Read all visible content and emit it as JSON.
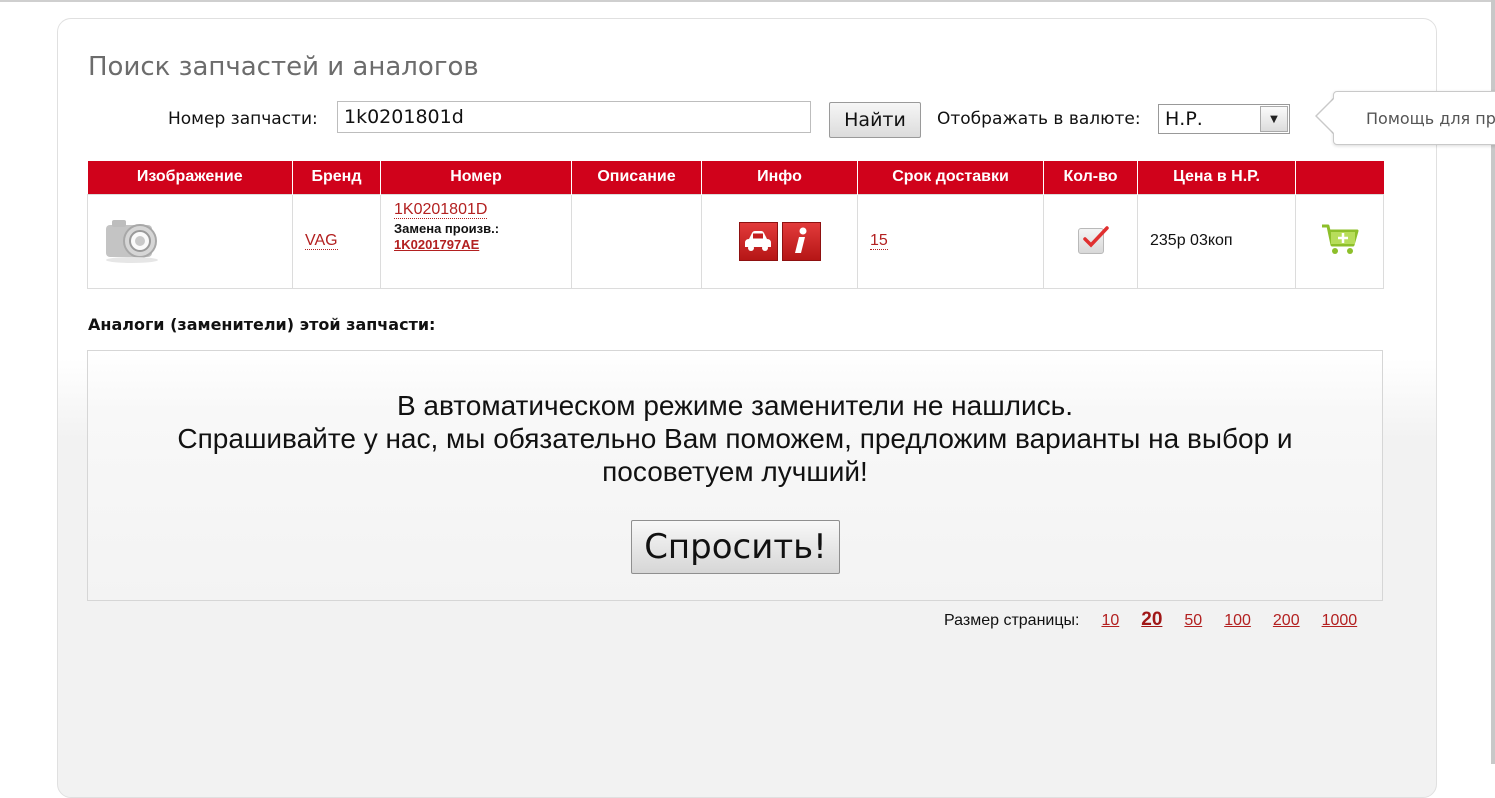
{
  "page": {
    "title": "Поиск запчастей и аналогов"
  },
  "search": {
    "label": "Номер запчасти:",
    "value": "1k0201801d",
    "button": "Найти",
    "currency_label": "Отображать в валюте:",
    "currency_value": "Н.Р."
  },
  "help": {
    "text": "Помощь для пр"
  },
  "table": {
    "headers": [
      "Изображение",
      "Бренд",
      "Номер",
      "Описание",
      "Инфо",
      "Срок доставки",
      "Кол-во",
      "Цена в Н.Р.",
      ""
    ],
    "rows": [
      {
        "image_icon": "camera-placeholder-icon",
        "brand": "VAG",
        "number": "1K0201801D",
        "replacement_label": "Замена произв.:",
        "replacement_number": "1K0201797AE",
        "description": "",
        "info_icons": [
          "car-icon",
          "info-icon"
        ],
        "delivery": "15",
        "qty_icon": "checkbox-checked-icon",
        "price": "235р 03коп",
        "cart_icon": "add-to-cart-icon"
      }
    ]
  },
  "analogs": {
    "title": "Аналоги (заменители) этой запчасти:",
    "message_line1": "В автоматическом режиме заменители не нашлись.",
    "message_line2": "Спрашивайте у нас, мы обязательно Вам поможем, предложим варианты на выбор и",
    "message_line3": "посоветуем лучший!",
    "ask_button": "Спросить!"
  },
  "pagination": {
    "label": "Размер страницы:",
    "sizes": [
      "10",
      "20",
      "50",
      "100",
      "200",
      "1000"
    ],
    "active": "20"
  },
  "colors": {
    "header_red": "#d0021b",
    "link_red": "#b32020",
    "cart_green": "#8dbf2a"
  }
}
